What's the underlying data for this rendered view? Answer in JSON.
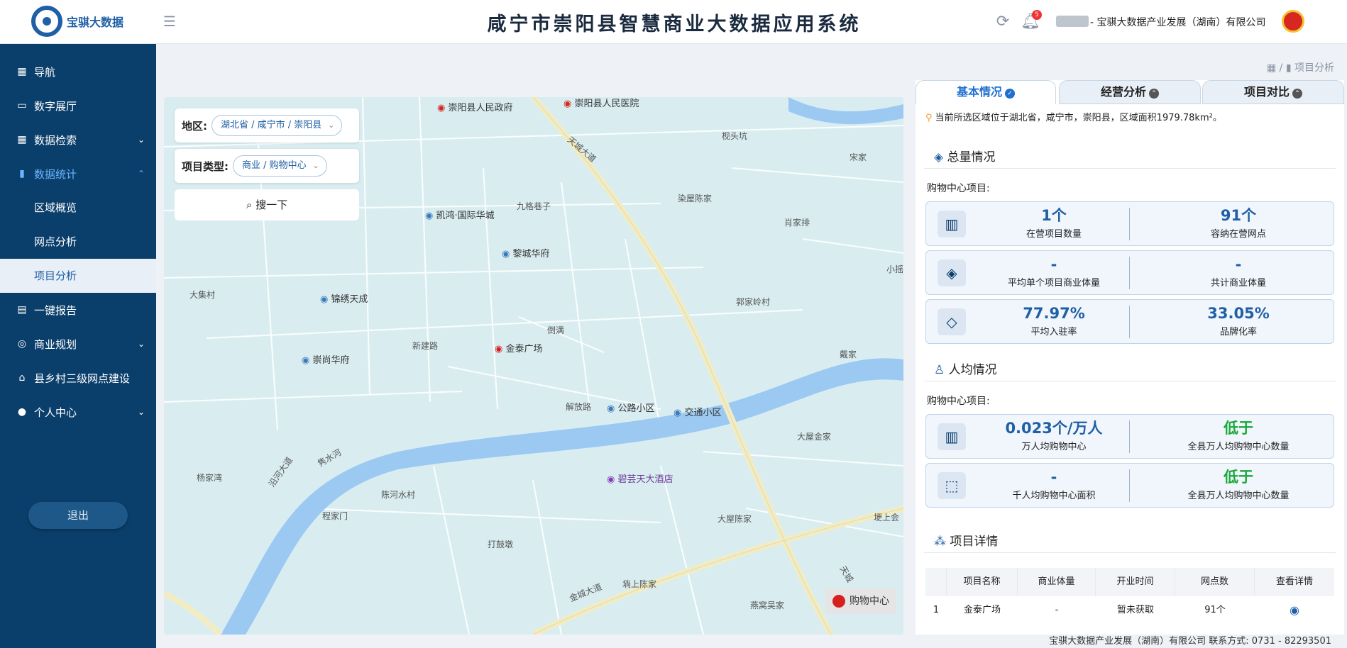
{
  "header": {
    "logo_text": "宝骐大数据",
    "title": "咸宁市崇阳县智慧商业大数据应用系统",
    "notification_count": "5",
    "company": "- 宝骐大数据产业发展（湖南）有限公司",
    "icons": [
      "menu-icon",
      "refresh-icon",
      "bell-icon",
      "national-emblem-icon"
    ]
  },
  "sidebar": {
    "items": [
      {
        "label": "导航",
        "icon": "grid-icon"
      },
      {
        "label": "数字展厅",
        "icon": "monitor-icon"
      },
      {
        "label": "数据检索",
        "icon": "search-grid-icon"
      },
      {
        "label": "数据统计",
        "icon": "bar-chart-icon"
      },
      {
        "label": "区域概览"
      },
      {
        "label": "网点分析"
      },
      {
        "label": "项目分析"
      },
      {
        "label": "一键报告",
        "icon": "clipboard-icon"
      },
      {
        "label": "商业规划",
        "icon": "pin-icon"
      },
      {
        "label": "县乡村三级网点建设",
        "icon": "bank-icon"
      },
      {
        "label": "个人中心",
        "icon": "user-icon"
      }
    ],
    "logout": "退出"
  },
  "breadcrumb": {
    "sep": "/",
    "current": "项目分析"
  },
  "map": {
    "filters": {
      "region_label": "地区:",
      "region_value": "湖北省 / 咸宁市 / 崇阳县",
      "type_label": "项目类型:",
      "type_value": "商业 / 购物中心",
      "search_label": "搜一下"
    },
    "labels": {
      "gov": "崇阳县人民政府",
      "hospital": "崇阳县人民医院",
      "tianchengdadao1": "天城大道",
      "jiugexiangzi": "九格巷子",
      "kaihong": "凯鸿·国际华城",
      "licheng": "黎城华府",
      "jinxiu": "锦绣天成",
      "dajicun": "大集村",
      "xinjianlu": "新建路",
      "jintai": "金泰广场",
      "chongshang": "崇尚华府",
      "jiefanglu": "解放路",
      "gonglu": "公路小区",
      "jiaotong": "交通小区",
      "jushuihe": "隽水河",
      "yanhedadao": "沿河大道",
      "biyun": "碧芸天大酒店",
      "yangjiawan": "杨家湾",
      "chenheshuicun": "陈河水村",
      "chengjiamen": "程家门",
      "dagudun": "打鼓墩",
      "jinchengdadao": "金城大道",
      "tanshangchenjia": "埫上陈家",
      "dawuchenjia": "大屋陈家",
      "yanwowujia": "燕窝吴家",
      "tianchengdadao2": "天城",
      "dawujinjia": "大屋金家",
      "daijia": "戴家",
      "guojialing": "郭家岭村",
      "xiaojiapai": "肖家排",
      "ranwuchenjia": "染屋陈家",
      "songjia": "宋家",
      "jiutoukeng": "枧头坑",
      "xiaoge": "小摇",
      "daoman": "倒满",
      "tanshang_right": "埂上会"
    },
    "legend": "购物中心"
  },
  "panel": {
    "tabs": [
      {
        "label": "基本情况",
        "active": true
      },
      {
        "label": "经营分析",
        "active": false
      },
      {
        "label": "项目对比",
        "active": false
      }
    ],
    "area_note": "当前所选区域位于湖北省，咸宁市，崇阳县，区域面积1979.78km²。",
    "total": {
      "title": "总量情况",
      "sub": "购物中心项目:",
      "cards": [
        {
          "icon": "building-icon",
          "v1": "1个",
          "l1": "在营项目数量",
          "v2": "91个",
          "l2": "容纳在营网点"
        },
        {
          "icon": "layers-icon",
          "v1": "-",
          "l1": "平均单个项目商业体量",
          "v2": "-",
          "l2": "共计商业体量"
        },
        {
          "icon": "diamond-icon",
          "v1": "77.97%",
          "l1": "平均入驻率",
          "v2": "33.05%",
          "l2": "品牌化率"
        }
      ]
    },
    "per_capita": {
      "title": "人均情况",
      "sub": "购物中心项目:",
      "cards": [
        {
          "icon": "building-icon",
          "v1": "0.023个/万人",
          "l1": "万人均购物中心",
          "v2": "低于",
          "l2": "全县万人均购物中心数量"
        },
        {
          "icon": "area-icon",
          "v1": "-",
          "l1": "千人均购物中心面积",
          "v2": "低于",
          "l2": "全县万人均购物中心数量"
        }
      ]
    },
    "detail": {
      "title": "项目详情",
      "columns": [
        "",
        "项目名称",
        "商业体量",
        "开业时间",
        "网点数",
        "查看详情"
      ],
      "rows": [
        [
          "1",
          "金泰广场",
          "-",
          "暂未获取",
          "91个"
        ]
      ]
    }
  },
  "footer": "宝骐大数据产业发展（湖南）有限公司 联系方式:  0731 - 82293501",
  "colors": {
    "sidebar": "#0b3f6b",
    "accent": "#1f5fa6",
    "river": "#9cc9f2",
    "road": "#f1ecc4",
    "green": "#1aa83a"
  }
}
